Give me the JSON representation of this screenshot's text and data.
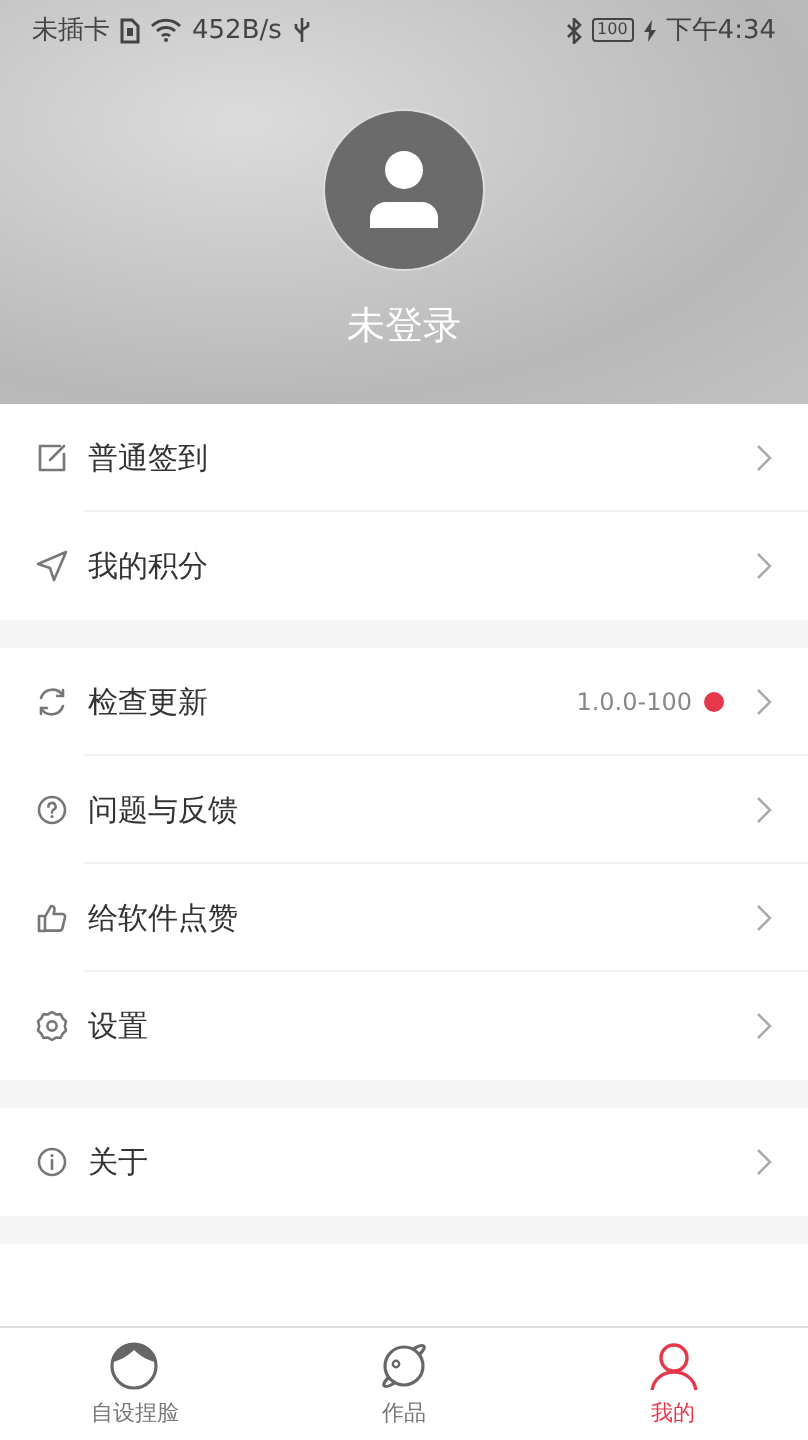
{
  "status_bar": {
    "carrier": "未插卡",
    "speed": "452B/s",
    "battery": "100",
    "time": "下午4:34"
  },
  "profile": {
    "name": "未登录"
  },
  "sections": [
    {
      "items": [
        {
          "label": "普通签到",
          "new": false
        },
        {
          "label": "我的积分",
          "new": false
        }
      ]
    },
    {
      "items": [
        {
          "label": "检查更新",
          "value": "1.0.0-100",
          "new": true
        },
        {
          "label": "问题与反馈",
          "new": false
        },
        {
          "label": "给软件点赞",
          "new": false
        },
        {
          "label": "设置",
          "new": false
        }
      ]
    },
    {
      "items": [
        {
          "label": "关于",
          "new": false
        }
      ]
    }
  ],
  "tabs": [
    {
      "label": "自设捏脸",
      "selected": false
    },
    {
      "label": "作品",
      "selected": false
    },
    {
      "label": "我的",
      "selected": true
    }
  ]
}
